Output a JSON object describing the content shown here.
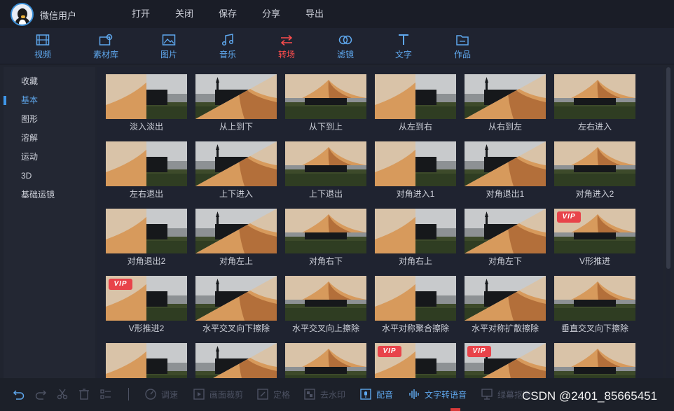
{
  "header": {
    "username": "微信用户",
    "menu": [
      "打开",
      "关闭",
      "保存",
      "分享",
      "导出"
    ]
  },
  "tabs": [
    {
      "label": "视频",
      "icon": "film-icon"
    },
    {
      "label": "素材库",
      "icon": "material-library-icon"
    },
    {
      "label": "图片",
      "icon": "image-icon"
    },
    {
      "label": "音乐",
      "icon": "music-note-icon"
    },
    {
      "label": "转场",
      "icon": "transition-arrows-icon"
    },
    {
      "label": "滤镜",
      "icon": "filter-circles-icon"
    },
    {
      "label": "文字",
      "icon": "text-t-icon"
    },
    {
      "label": "作品",
      "icon": "folder-icon"
    }
  ],
  "active_tab": "转场",
  "sidebar": {
    "items": [
      "收藏",
      "基本",
      "图形",
      "溶解",
      "运动",
      "3D",
      "基础运镜"
    ],
    "active": "基本"
  },
  "transitions": [
    {
      "name": "淡入淡出",
      "vip": false
    },
    {
      "name": "从上到下",
      "vip": false
    },
    {
      "name": "从下到上",
      "vip": false
    },
    {
      "name": "从左到右",
      "vip": false
    },
    {
      "name": "从右到左",
      "vip": false
    },
    {
      "name": "左右进入",
      "vip": false
    },
    {
      "name": "左右退出",
      "vip": false
    },
    {
      "name": "上下进入",
      "vip": false
    },
    {
      "name": "上下退出",
      "vip": false
    },
    {
      "name": "对角进入1",
      "vip": false
    },
    {
      "name": "对角退出1",
      "vip": false
    },
    {
      "name": "对角进入2",
      "vip": false
    },
    {
      "name": "对角退出2",
      "vip": false
    },
    {
      "name": "对角左上",
      "vip": false
    },
    {
      "name": "对角右下",
      "vip": false
    },
    {
      "name": "对角右上",
      "vip": false
    },
    {
      "name": "对角左下",
      "vip": false
    },
    {
      "name": "V形推进",
      "vip": true
    },
    {
      "name": "V形推进2",
      "vip": true
    },
    {
      "name": "水平交叉向下擦除",
      "vip": false
    },
    {
      "name": "水平交叉向上擦除",
      "vip": false
    },
    {
      "name": "水平对称聚合擦除",
      "vip": false
    },
    {
      "name": "水平对称扩散擦除",
      "vip": false
    },
    {
      "name": "垂直交叉向下擦除",
      "vip": false
    },
    {
      "name": "",
      "vip": false
    },
    {
      "name": "",
      "vip": false
    },
    {
      "name": "",
      "vip": false
    },
    {
      "name": "",
      "vip": true
    },
    {
      "name": "",
      "vip": true
    },
    {
      "name": "",
      "vip": false
    }
  ],
  "vip_badge": "VIP",
  "bottom": {
    "tools": [
      {
        "label": "",
        "icon": "undo-icon",
        "state": "lit"
      },
      {
        "label": "",
        "icon": "redo-icon",
        "state": "dim"
      },
      {
        "label": "",
        "icon": "scissors-icon",
        "state": "dim"
      },
      {
        "label": "",
        "icon": "trash-icon",
        "state": "dim"
      },
      {
        "label": "",
        "icon": "settings-sliders-icon",
        "state": "dim"
      },
      {
        "label": "调速",
        "icon": "speed-gauge-icon",
        "state": "dim"
      },
      {
        "label": "画面裁剪",
        "icon": "crop-icon",
        "state": "dim"
      },
      {
        "label": "定格",
        "icon": "freeze-frame-icon",
        "state": "dim"
      },
      {
        "label": "去水印",
        "icon": "remove-watermark-icon",
        "state": "dim"
      },
      {
        "label": "配音",
        "icon": "dubbing-icon",
        "state": "lit"
      },
      {
        "label": "文字转语音",
        "icon": "text-to-speech-icon",
        "state": "lit"
      },
      {
        "label": "绿幕抠图",
        "icon": "green-screen-icon",
        "state": "dim"
      }
    ]
  },
  "watermark": "CSDN @2401_85665451",
  "colors": {
    "accent_blue": "#5fa8ee",
    "active_red": "#ff4d4d",
    "vip_red": "#e8434a",
    "background": "#1f2330"
  }
}
